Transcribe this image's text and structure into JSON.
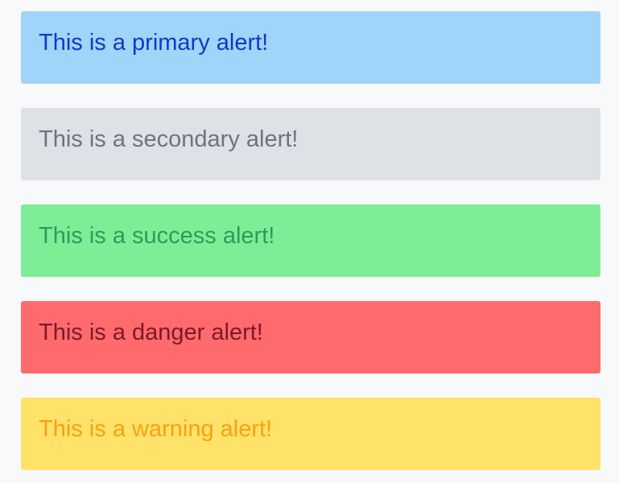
{
  "alerts": [
    {
      "variant": "primary",
      "text": "This is a primary alert!",
      "bg": "#a0d4f8",
      "color": "#1438c4"
    },
    {
      "variant": "secondary",
      "text": "This is a secondary alert!",
      "bg": "#dee1e6",
      "color": "#6c757d"
    },
    {
      "variant": "success",
      "text": "This is a success alert!",
      "bg": "#7fed96",
      "color": "#2f9a5c"
    },
    {
      "variant": "danger",
      "text": "This is a danger alert!",
      "bg": "#ff6a6d",
      "color": "#7b1a2a"
    },
    {
      "variant": "warning",
      "text": "This is a warning alert!",
      "bg": "#ffe26a",
      "color": "#f8a10f"
    }
  ]
}
